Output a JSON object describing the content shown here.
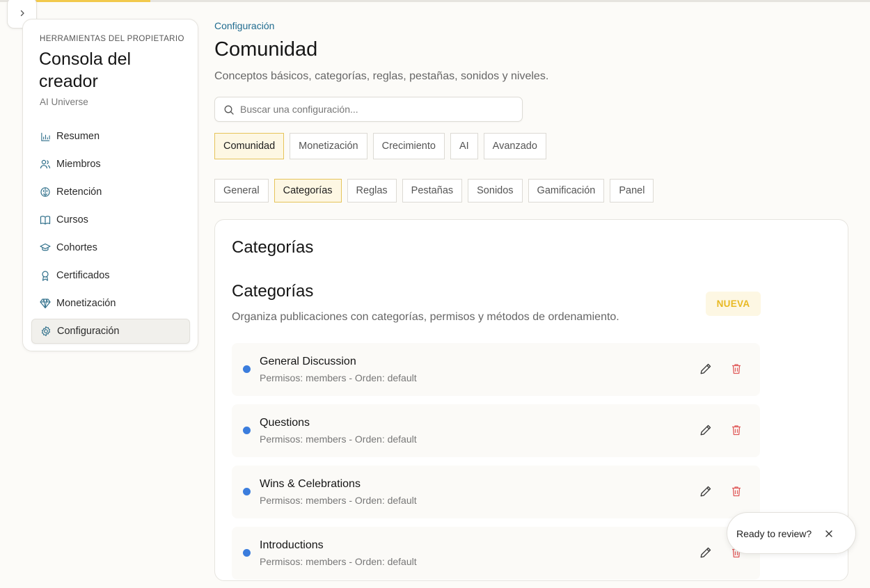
{
  "sidebar": {
    "kicker": "HERRAMIENTAS DEL PROPIETARIO",
    "title": "Consola del creador",
    "subtitle": "AI Universe",
    "items": [
      {
        "label": "Resumen",
        "icon": "bar-chart-icon"
      },
      {
        "label": "Miembros",
        "icon": "users-icon"
      },
      {
        "label": "Retención",
        "icon": "brain-icon"
      },
      {
        "label": "Cursos",
        "icon": "book-icon"
      },
      {
        "label": "Cohortes",
        "icon": "graduation-cap-icon"
      },
      {
        "label": "Certificados",
        "icon": "award-icon"
      },
      {
        "label": "Monetización",
        "icon": "gem-icon"
      },
      {
        "label": "Configuración",
        "icon": "gear-icon",
        "active": true
      }
    ]
  },
  "header": {
    "breadcrumb": "Configuración",
    "title": "Comunidad",
    "subtitle": "Conceptos básicos, categorías, reglas, pestañas, sonidos y niveles."
  },
  "search": {
    "placeholder": "Buscar una configuración..."
  },
  "primary_tabs": [
    "Comunidad",
    "Monetización",
    "Crecimiento",
    "AI",
    "Avanzado"
  ],
  "primary_active": "Comunidad",
  "secondary_tabs": [
    "General",
    "Categorías",
    "Reglas",
    "Pestañas",
    "Sonidos",
    "Gamificación",
    "Panel"
  ],
  "secondary_active": "Categorías",
  "card": {
    "title": "Categorías",
    "section_title": "Categorías",
    "section_desc": "Organiza publicaciones con categorías, permisos y métodos de ordenamiento.",
    "new_label": "NUEVA",
    "categories": [
      {
        "name": "General Discussion",
        "meta": "Permisos: members - Orden: default"
      },
      {
        "name": "Questions",
        "meta": "Permisos: members - Orden: default"
      },
      {
        "name": "Wins & Celebrations",
        "meta": "Permisos: members - Orden: default"
      },
      {
        "name": "Introductions",
        "meta": "Permisos: members - Orden: default"
      }
    ]
  },
  "toast": {
    "text": "Ready to review?"
  },
  "colors": {
    "accent": "#f2c94c",
    "link": "#1f6b8f",
    "dot": "#3b7ddd",
    "danger": "#e05a5a"
  }
}
